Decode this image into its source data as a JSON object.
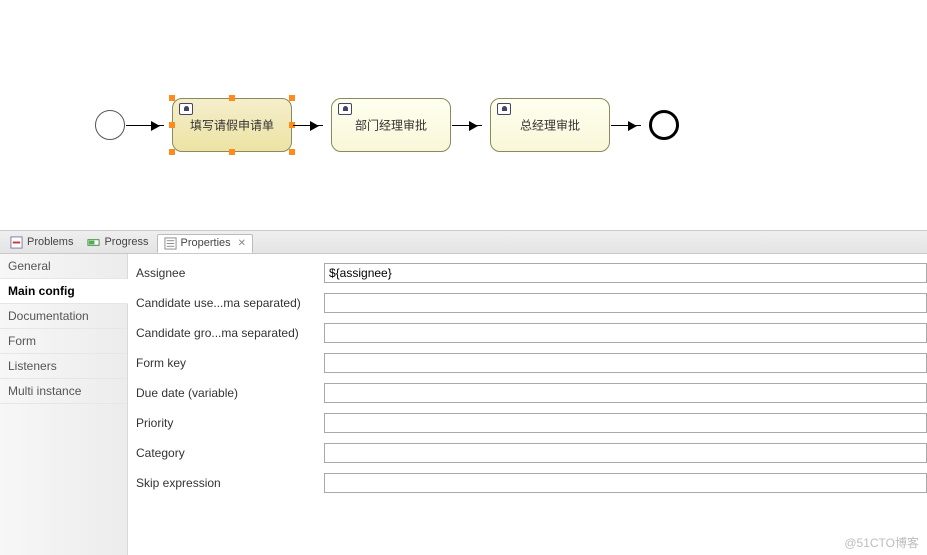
{
  "diagram": {
    "tasks": [
      {
        "label": "填写请假申请单",
        "selected": true
      },
      {
        "label": "部门经理审批"
      },
      {
        "label": "总经理审批"
      }
    ]
  },
  "viewTabs": {
    "problems": "Problems",
    "progress": "Progress",
    "properties": "Properties"
  },
  "sideTabs": {
    "general": "General",
    "mainConfig": "Main config",
    "documentation": "Documentation",
    "form": "Form",
    "listeners": "Listeners",
    "multiInstance": "Multi instance"
  },
  "fields": {
    "assignee": {
      "label": "Assignee",
      "value": "${assignee}"
    },
    "candidateUsers": {
      "label": "Candidate use...ma separated)",
      "value": ""
    },
    "candidateGroups": {
      "label": "Candidate gro...ma separated)",
      "value": ""
    },
    "formKey": {
      "label": "Form key",
      "value": ""
    },
    "dueDate": {
      "label": "Due date (variable)",
      "value": ""
    },
    "priority": {
      "label": "Priority",
      "value": ""
    },
    "category": {
      "label": "Category",
      "value": ""
    },
    "skipExpression": {
      "label": "Skip expression",
      "value": ""
    }
  },
  "watermark": "@51CTO博客"
}
